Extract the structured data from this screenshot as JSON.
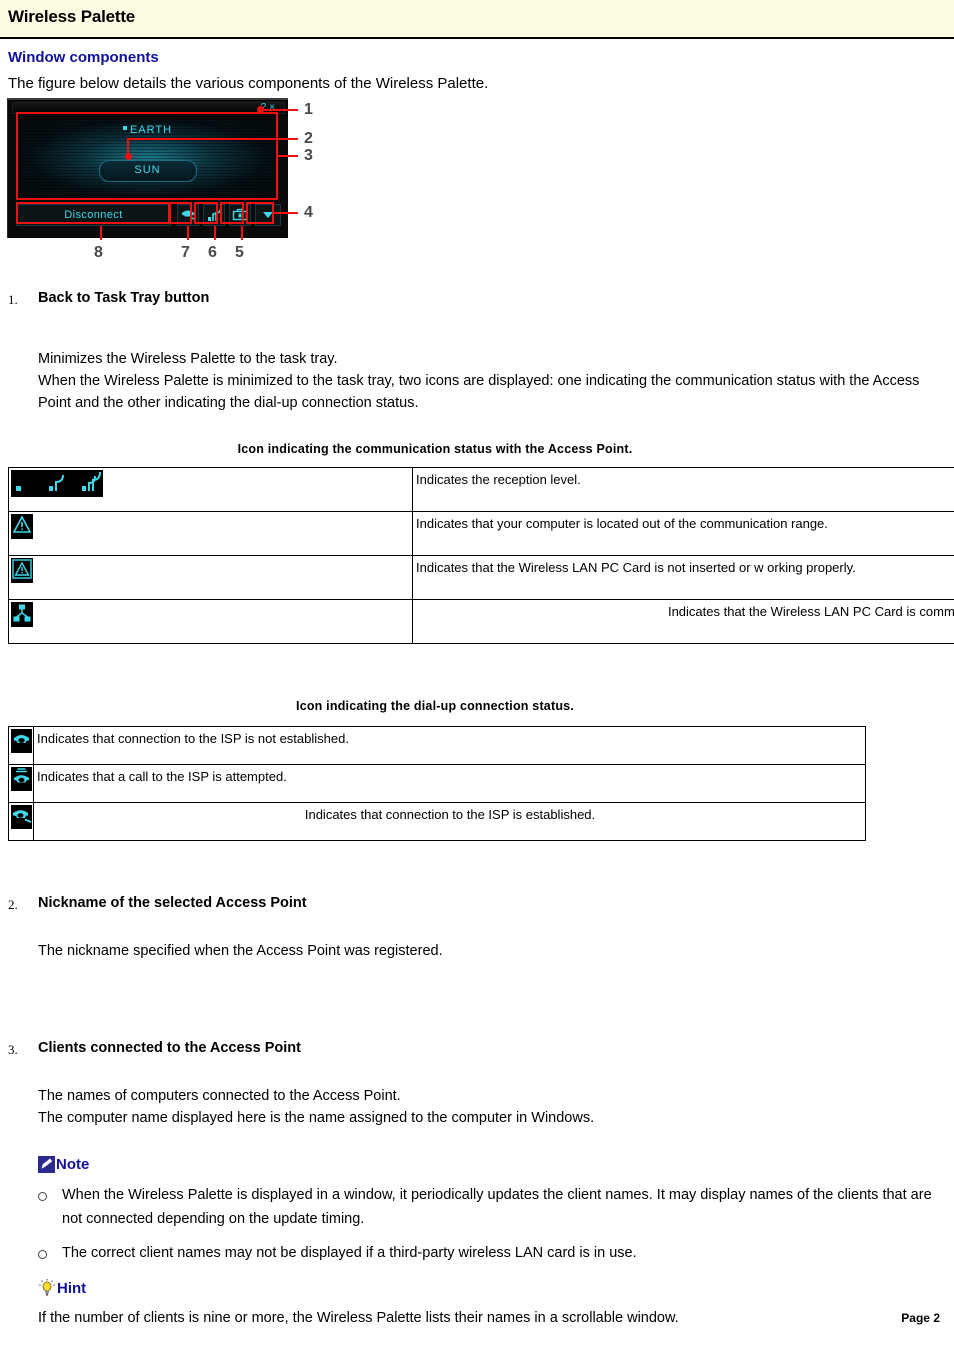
{
  "document": {
    "title": "Wireless Palette",
    "page_label": "Page 2"
  },
  "section": {
    "heading": "Window components",
    "intro": "The figure below details the various components of the Wireless Palette."
  },
  "figure": {
    "window": {
      "help_button": "?",
      "close_button": "×",
      "access_point_name": "EARTH",
      "client_name": "SUN",
      "disconnect_label": "Disconnect",
      "buttons": [
        {
          "index": "7",
          "icon": "telephone-icon"
        },
        {
          "index": "6",
          "icon": "signal-strength-icon"
        },
        {
          "index": "5",
          "icon": "toolbox-icon"
        },
        {
          "index": "4",
          "icon": "chevron-down-icon"
        }
      ]
    },
    "callouts": [
      "1",
      "2",
      "3",
      "4",
      "5",
      "6",
      "7",
      "8"
    ],
    "colors": {
      "annotation": "#ee1111",
      "cyan": "#3fd8ea",
      "window_bg": "#0a0a0a"
    }
  },
  "items": [
    {
      "number": "1.",
      "heading": "Back to Task Tray button",
      "paragraphs": [
        "Minimizes the Wireless Palette to the task tray.",
        "When the Wireless Palette is minimized to the task tray, two icons are displayed: one indicating the communication status with the Access Point and the other indicating the dial-up connection status."
      ]
    },
    {
      "number": "2.",
      "heading": "Nickname of the selected Access Point",
      "paragraphs": [
        "The nickname specified when the Access Point was registered."
      ]
    },
    {
      "number": "3.",
      "heading": "Clients connected to the Access Point",
      "paragraphs": [
        "The names of computers connected to the Access Point.",
        "The computer name displayed here is the name assigned to the computer in Windows."
      ]
    }
  ],
  "comm_table": {
    "caption": "Icon indicating the communication status with the Access Point.",
    "rows": [
      {
        "icon": "signal-level-icons",
        "text": "Indicates the reception level.",
        "align": "left"
      },
      {
        "icon": "warning-triangle-icon",
        "text": "Indicates that your computer is located out of the communication range.",
        "align": "left"
      },
      {
        "icon": "card-error-icon",
        "text": "Indicates that the Wireless LAN PC Card is not inserted or w orking properly.",
        "align": "left"
      },
      {
        "icon": "peer-network-icon",
        "text": "Indicates that the Wireless LAN PC Card is communicating in th",
        "align": "right"
      }
    ]
  },
  "dial_table": {
    "caption": "Icon indicating the dial-up connection status.",
    "rows": [
      {
        "icon": "telephone-idle-icon",
        "text": "Indicates that connection to the ISP is not established.",
        "align": "left"
      },
      {
        "icon": "telephone-ringing-icon",
        "text": "Indicates that a call to the ISP is attempted.",
        "align": "left"
      },
      {
        "icon": "telephone-connected-icon",
        "text": "Indicates that connection to the ISP is established.",
        "align": "center"
      }
    ]
  },
  "note": {
    "label": "Note",
    "bullets": [
      "When the Wireless Palette is displayed in a window, it periodically updates the client names. It may display names of the clients that are not connected depending on the update timing.",
      "The correct client names may not be displayed if a third-party wireless LAN card is in use."
    ]
  },
  "hint": {
    "label": "Hint",
    "text": "If the number of clients is nine or more, the Wireless Palette lists their names in a scrollable window."
  }
}
